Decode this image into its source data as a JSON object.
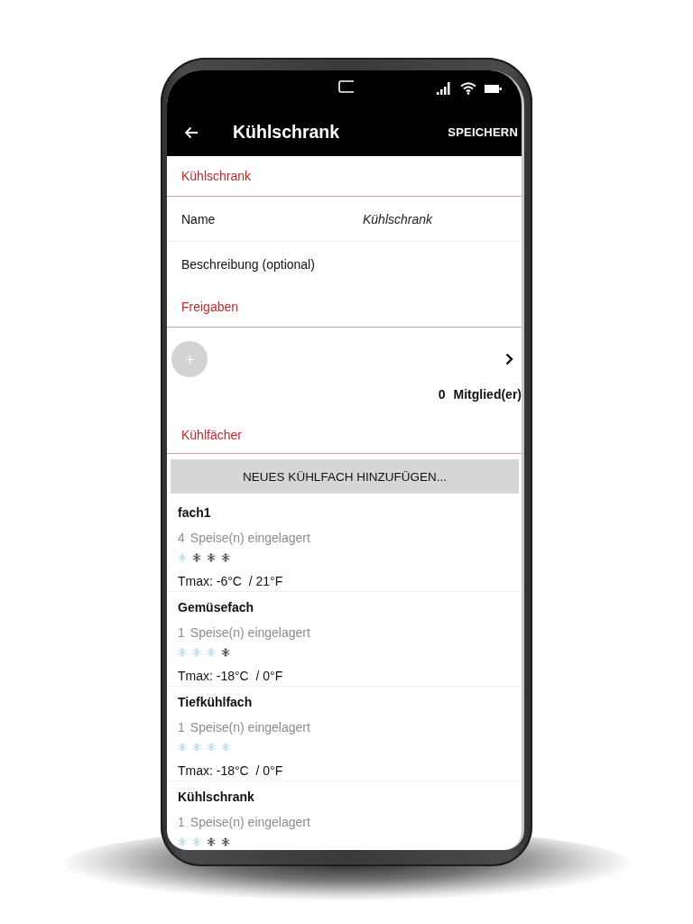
{
  "app_bar": {
    "title": "Kühlschrank",
    "action": "SPEICHERN"
  },
  "fridge": {
    "heading": "Kühlschrank",
    "fields": [
      {
        "label": "Name",
        "value": "Kühlschrank"
      },
      {
        "label": "Beschreibung (optional)"
      }
    ]
  },
  "sharing": {
    "heading": "Freigaben",
    "member_count": "0",
    "member_label": "Mitglied(er)"
  },
  "compartments": {
    "heading": "Kühlfächer",
    "add_button": "NEUES KÜHLFACH HINZUFÜGEN...",
    "items": [
      {
        "name": "fach1",
        "count": "4",
        "stored_label": "Speise(n) eingelagert",
        "stars": 1,
        "tmax": "Tmax: -6°C  / 21°F"
      },
      {
        "name": "Gemüsefach",
        "count": "1",
        "stored_label": "Speise(n) eingelagert",
        "stars": 3,
        "tmax": "Tmax: -18°C  / 0°F"
      },
      {
        "name": "Tiefkühlfach",
        "count": "1",
        "stored_label": "Speise(n) eingelagert",
        "stars": 4,
        "tmax": "Tmax: -18°C  / 0°F"
      },
      {
        "name": "Kühlschrank",
        "count": "1",
        "stored_label": "Speise(n) eingelagert",
        "stars": 2
      }
    ]
  }
}
